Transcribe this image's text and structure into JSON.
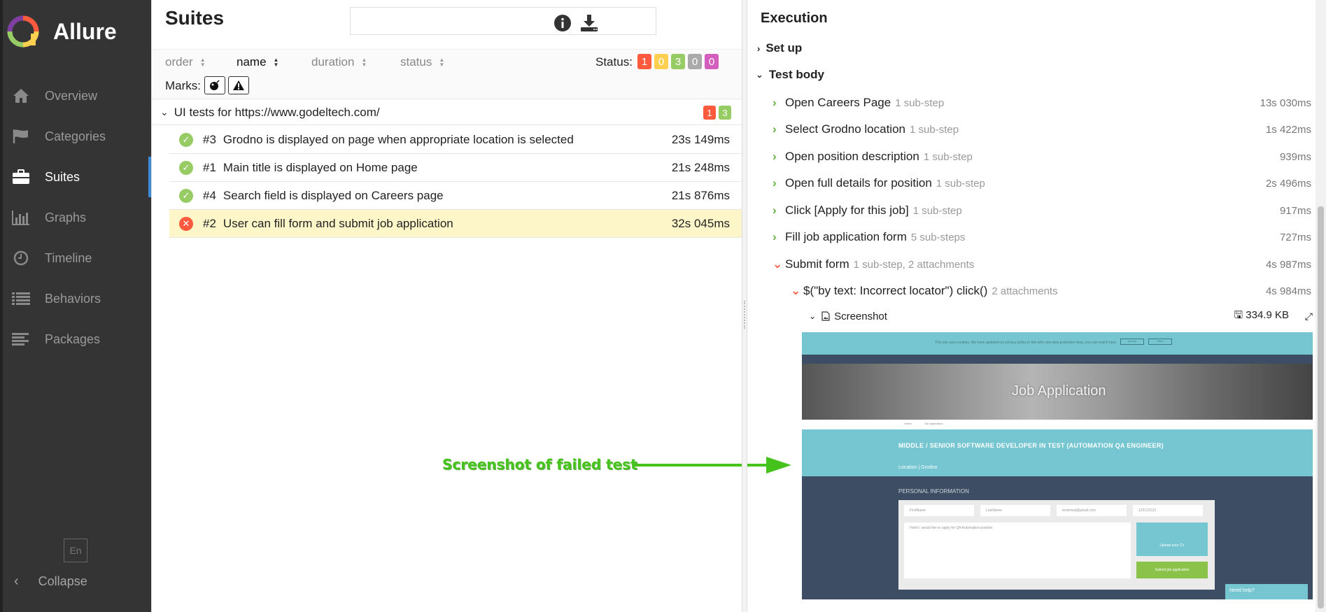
{
  "app": {
    "name": "Allure"
  },
  "sidebar": {
    "items": [
      {
        "label": "Overview",
        "icon": "home-icon"
      },
      {
        "label": "Categories",
        "icon": "flag-icon"
      },
      {
        "label": "Suites",
        "icon": "briefcase-icon",
        "active": true
      },
      {
        "label": "Graphs",
        "icon": "bar-chart-icon"
      },
      {
        "label": "Timeline",
        "icon": "clock-icon"
      },
      {
        "label": "Behaviors",
        "icon": "list-icon"
      },
      {
        "label": "Packages",
        "icon": "align-left-icon"
      }
    ],
    "language": "En",
    "collapse_label": "Collapse"
  },
  "suites": {
    "title": "Suites",
    "search": {
      "value": "",
      "placeholder": ""
    },
    "sort": {
      "order": "order",
      "name": "name",
      "duration": "duration",
      "status": "status"
    },
    "status_label": "Status:",
    "status_counts": [
      "1",
      "0",
      "3",
      "0",
      "0"
    ],
    "marks_label": "Marks:",
    "group": {
      "name": "UI tests for https://www.godeltech.com/",
      "failed": "1",
      "passed": "3"
    },
    "tests": [
      {
        "num": "#3",
        "name": "Grodno is displayed on page when appropriate location is selected",
        "duration": "23s 149ms",
        "status": "passed"
      },
      {
        "num": "#1",
        "name": "Main title is displayed on Home page",
        "duration": "21s 248ms",
        "status": "passed"
      },
      {
        "num": "#4",
        "name": "Search field is displayed on Careers page",
        "duration": "21s 876ms",
        "status": "passed"
      },
      {
        "num": "#2",
        "name": "User can fill form and submit job application",
        "duration": "32s 045ms",
        "status": "failed"
      }
    ]
  },
  "execution": {
    "title": "Execution",
    "setup_label": "Set up",
    "body_label": "Test body",
    "steps": [
      {
        "name": "Open Careers Page",
        "sub": "1 sub-step",
        "duration": "13s 030ms"
      },
      {
        "name": "Select Grodno location",
        "sub": "1 sub-step",
        "duration": "1s 422ms"
      },
      {
        "name": "Open position description",
        "sub": "1 sub-step",
        "duration": "939ms"
      },
      {
        "name": "Open full details for position",
        "sub": "1 sub-step",
        "duration": "2s 496ms"
      },
      {
        "name": "Click [Apply for this job]",
        "sub": "1 sub-step",
        "duration": "917ms"
      },
      {
        "name": "Fill job application form",
        "sub": "5 sub-steps",
        "duration": "727ms"
      },
      {
        "name": "Submit form",
        "sub": "1 sub-step, 2 attachments",
        "duration": "4s 987ms"
      }
    ],
    "substep": {
      "name": "$(\"by text: Incorrect locator\") click()",
      "sub": "2 attachments",
      "duration": "4s 984ms"
    },
    "attachment": {
      "name": "Screenshot",
      "size": "334.9 KB"
    }
  },
  "screenshot": {
    "cookie_text": "This site uses cookies. We have updated our privacy policy in line with new data protection laws, you can read it here.",
    "accept": "Accept",
    "more": "More",
    "hero_title": "Job Application",
    "crumb_home": "Home",
    "crumb_current": "Job application",
    "job_title": "MIDDLE / SENIOR SOFTWARE DEVELOPER IN TEST (AUTOMATION QA ENGINEER)",
    "location": "Location  |  Grodno",
    "section": "PERSONAL INFORMATION",
    "fields": [
      "FirstName",
      "LastName",
      "testemail@gmail.com",
      "123123123"
    ],
    "message": "Hello! I would like to apply for QA Automation position",
    "upload": "Upload your CV",
    "submit": "Submit job application",
    "need_help": "Need help?"
  },
  "annotation": {
    "text": "Screenshot of failed test",
    "color": "#45c21c"
  },
  "colors": {
    "failed": "#fd5a3e",
    "broken": "#ffd050",
    "passed": "#97cc64",
    "skipped": "#aaaaaa",
    "unknown": "#d35ebe",
    "sidebar": "#343434",
    "accent": "#3e8ad6"
  }
}
